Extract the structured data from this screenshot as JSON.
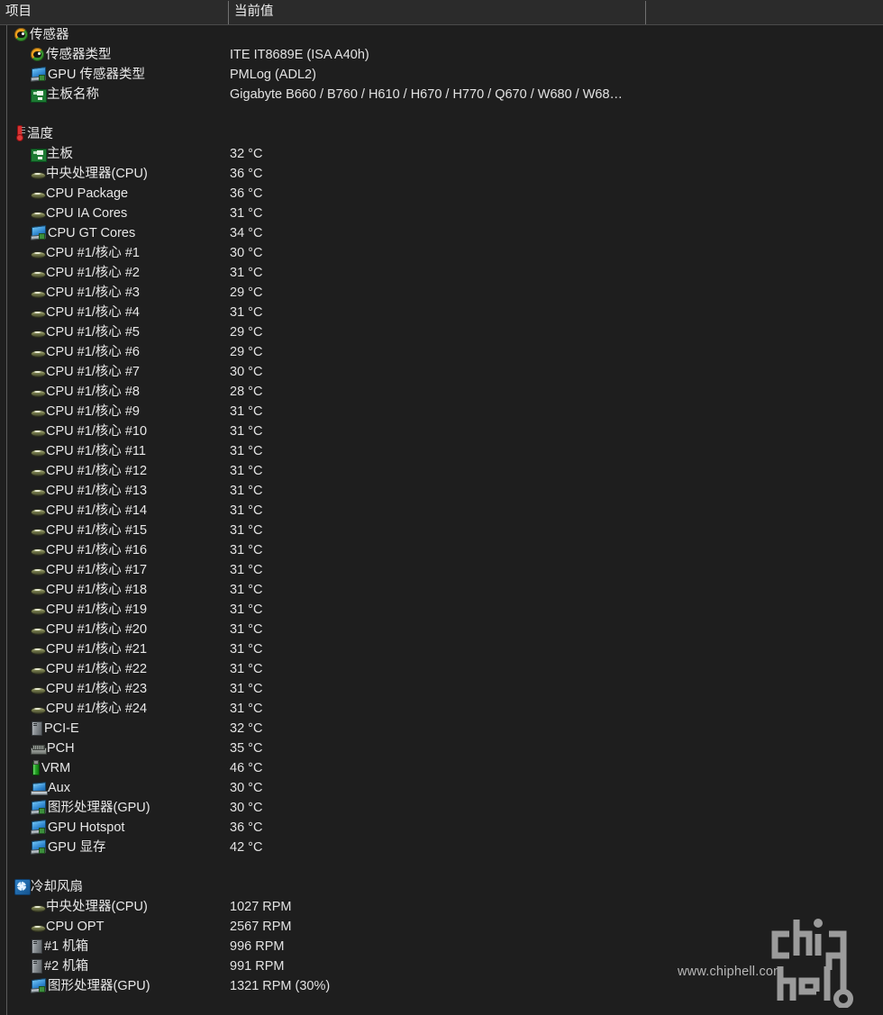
{
  "header": {
    "columns": [
      "项目",
      "当前值",
      ""
    ]
  },
  "colors": {
    "background": "#1e1e1e",
    "header_background": "#2b2b2b",
    "text": "#e8e8e8",
    "rail": "#5a5a5a",
    "sensor_icon": "#3f9b33",
    "gpu_icon": "#2f86cf",
    "mainboard_icon": "#1d7a33",
    "thermometer_icon": "#d83232",
    "vrm_icon": "#25a325",
    "fan_icon": "#2d7fc4"
  },
  "sections": [
    {
      "name": "sensors",
      "title": "传感器",
      "icon": "sensor-icon",
      "rows": [
        {
          "icon": "sensor-icon",
          "label": "传感器类型",
          "value": "ITE IT8689E  (ISA A40h)"
        },
        {
          "icon": "gpu-icon",
          "label": "GPU 传感器类型",
          "value": "PMLog  (ADL2)"
        },
        {
          "icon": "mainboard-icon",
          "label": "主板名称",
          "value": "Gigabyte B660 / B760 / H610 / H670 / H770 / Q670 / W680 / W68…"
        }
      ]
    },
    {
      "name": "temperatures",
      "title": "温度",
      "icon": "thermometer-icon",
      "rows": [
        {
          "icon": "mainboard-icon",
          "label": "主板",
          "value": "32 °C"
        },
        {
          "icon": "cpu-icon",
          "label": "中央处理器(CPU)",
          "value": "36 °C"
        },
        {
          "icon": "cpu-icon",
          "label": "CPU Package",
          "value": "36 °C"
        },
        {
          "icon": "cpu-icon",
          "label": "CPU IA Cores",
          "value": "31 °C"
        },
        {
          "icon": "gpu-icon",
          "label": "CPU GT Cores",
          "value": "34 °C"
        },
        {
          "icon": "cpu-icon",
          "label": "CPU #1/核心 #1",
          "value": "30 °C"
        },
        {
          "icon": "cpu-icon",
          "label": "CPU #1/核心 #2",
          "value": "31 °C"
        },
        {
          "icon": "cpu-icon",
          "label": "CPU #1/核心 #3",
          "value": "29 °C"
        },
        {
          "icon": "cpu-icon",
          "label": "CPU #1/核心 #4",
          "value": "31 °C"
        },
        {
          "icon": "cpu-icon",
          "label": "CPU #1/核心 #5",
          "value": "29 °C"
        },
        {
          "icon": "cpu-icon",
          "label": "CPU #1/核心 #6",
          "value": "29 °C"
        },
        {
          "icon": "cpu-icon",
          "label": "CPU #1/核心 #7",
          "value": "30 °C"
        },
        {
          "icon": "cpu-icon",
          "label": "CPU #1/核心 #8",
          "value": "28 °C"
        },
        {
          "icon": "cpu-icon",
          "label": "CPU #1/核心 #9",
          "value": "31 °C"
        },
        {
          "icon": "cpu-icon",
          "label": "CPU #1/核心 #10",
          "value": "31 °C"
        },
        {
          "icon": "cpu-icon",
          "label": "CPU #1/核心 #11",
          "value": "31 °C"
        },
        {
          "icon": "cpu-icon",
          "label": "CPU #1/核心 #12",
          "value": "31 °C"
        },
        {
          "icon": "cpu-icon",
          "label": "CPU #1/核心 #13",
          "value": "31 °C"
        },
        {
          "icon": "cpu-icon",
          "label": "CPU #1/核心 #14",
          "value": "31 °C"
        },
        {
          "icon": "cpu-icon",
          "label": "CPU #1/核心 #15",
          "value": "31 °C"
        },
        {
          "icon": "cpu-icon",
          "label": "CPU #1/核心 #16",
          "value": "31 °C"
        },
        {
          "icon": "cpu-icon",
          "label": "CPU #1/核心 #17",
          "value": "31 °C"
        },
        {
          "icon": "cpu-icon",
          "label": "CPU #1/核心 #18",
          "value": "31 °C"
        },
        {
          "icon": "cpu-icon",
          "label": "CPU #1/核心 #19",
          "value": "31 °C"
        },
        {
          "icon": "cpu-icon",
          "label": "CPU #1/核心 #20",
          "value": "31 °C"
        },
        {
          "icon": "cpu-icon",
          "label": "CPU #1/核心 #21",
          "value": "31 °C"
        },
        {
          "icon": "cpu-icon",
          "label": "CPU #1/核心 #22",
          "value": "31 °C"
        },
        {
          "icon": "cpu-icon",
          "label": "CPU #1/核心 #23",
          "value": "31 °C"
        },
        {
          "icon": "cpu-icon",
          "label": "CPU #1/核心 #24",
          "value": "31 °C"
        },
        {
          "icon": "case-icon",
          "label": "PCI-E",
          "value": "32 °C"
        },
        {
          "icon": "pch-icon",
          "label": "PCH",
          "value": "35 °C"
        },
        {
          "icon": "vrm-icon",
          "label": "VRM",
          "value": "46 °C"
        },
        {
          "icon": "aux-icon",
          "label": "Aux",
          "value": "30 °C"
        },
        {
          "icon": "gpu-icon",
          "label": "图形处理器(GPU)",
          "value": "30 °C"
        },
        {
          "icon": "gpu-icon",
          "label": "GPU Hotspot",
          "value": "36 °C"
        },
        {
          "icon": "gpu-icon",
          "label": "GPU 显存",
          "value": "42 °C"
        }
      ]
    },
    {
      "name": "cooling-fans",
      "title": "冷却风扇",
      "icon": "fan-icon",
      "rows": [
        {
          "icon": "cpu-icon",
          "label": "中央处理器(CPU)",
          "value": "1027 RPM"
        },
        {
          "icon": "cpu-icon",
          "label": "CPU OPT",
          "value": "2567 RPM"
        },
        {
          "icon": "case-icon",
          "label": "#1 机箱",
          "value": "996 RPM"
        },
        {
          "icon": "case-icon",
          "label": "#2 机箱",
          "value": "991 RPM"
        },
        {
          "icon": "gpu-icon",
          "label": "图形处理器(GPU)",
          "value": "1321 RPM  (30%)"
        }
      ]
    }
  ],
  "watermark": {
    "url": "www.chiphell.com",
    "logo_text": "chiphell"
  }
}
